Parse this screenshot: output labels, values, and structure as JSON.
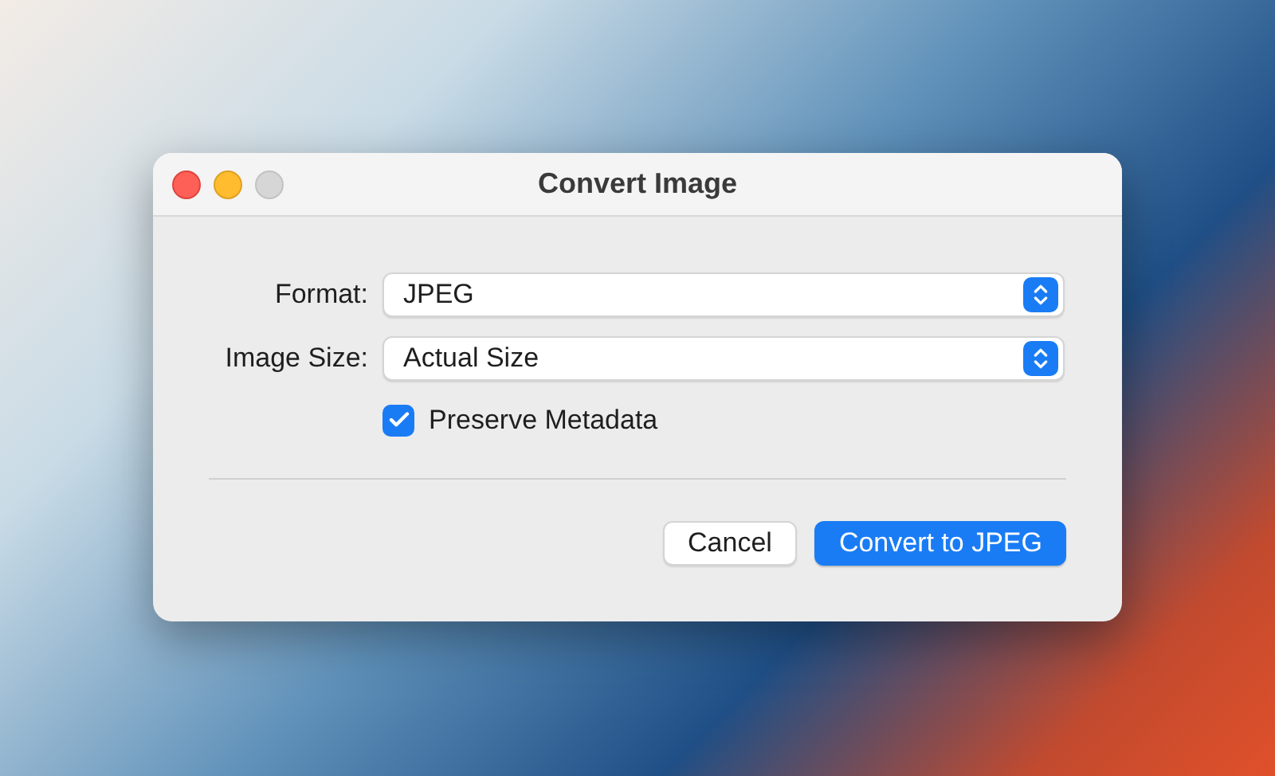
{
  "window": {
    "title": "Convert Image",
    "controls": [
      {
        "kind": "close",
        "disabled": false
      },
      {
        "kind": "minimize",
        "disabled": false
      },
      {
        "kind": "zoom",
        "disabled": true
      }
    ]
  },
  "fields": [
    {
      "label": "Format:",
      "value": "JPEG"
    },
    {
      "label": "Image Size:",
      "value": "Actual Size"
    }
  ],
  "checkbox": {
    "label": "Preserve Metadata",
    "checked": true
  },
  "buttons": [
    {
      "label": "Cancel",
      "kind": "secondary"
    },
    {
      "label": "Convert to JPEG",
      "kind": "primary"
    }
  ]
}
